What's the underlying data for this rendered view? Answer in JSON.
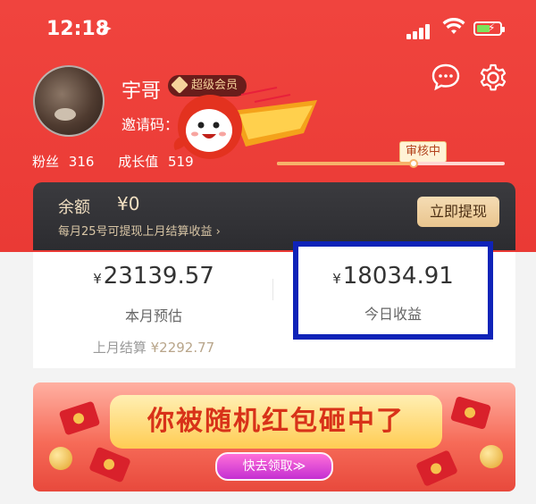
{
  "status_bar": {
    "time": "12:18"
  },
  "profile": {
    "name": "宇哥",
    "badge": "超级会员",
    "invite_label": "邀请码："
  },
  "stats": {
    "fans_label": "粉丝",
    "fans_value": "316",
    "growth_label": "成长值",
    "growth_value": "519"
  },
  "review_tag": "审核中",
  "progress": {
    "fraction": 0.6
  },
  "balance": {
    "label": "余额",
    "value": "¥0",
    "note": "每月25号可提现上月结算收益 ›",
    "withdraw_label": "立即提现"
  },
  "earnings": {
    "currency": "¥",
    "month_estimate_value": "23139.57",
    "month_estimate_label": "本月预估",
    "last_month_label": "上月结算",
    "last_month_value": "¥2292.77",
    "today_value": "18034.91",
    "today_label": "今日收益"
  },
  "banner": {
    "title": "你被随机红包砸中了",
    "button": "快去领取≫"
  },
  "colors": {
    "header_red": "#f0443e",
    "highlight_blue": "#0f23b8",
    "gold": "#f2e0c2"
  }
}
